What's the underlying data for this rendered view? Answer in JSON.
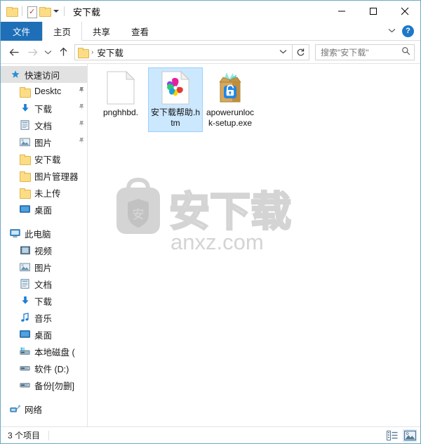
{
  "window": {
    "title": "安下载",
    "quick_access_toolbar": [
      {
        "name": "folder-icon",
        "label": "文件夹"
      },
      {
        "name": "properties-icon",
        "label": "属性"
      },
      {
        "name": "new-folder-icon",
        "label": "新建文件夹"
      },
      {
        "name": "chevron-down-icon",
        "label": "自定义快速访问工具栏"
      }
    ],
    "controls": {
      "minimize": "最小化",
      "maximize": "最大化",
      "close": "关闭"
    }
  },
  "ribbon": {
    "tabs": [
      {
        "label": "文件",
        "state": "file"
      },
      {
        "label": "主页",
        "state": "active"
      },
      {
        "label": "共享",
        "state": "normal"
      },
      {
        "label": "查看",
        "state": "normal"
      }
    ],
    "collapse_icon": "⌄",
    "help_label": "?",
    "accent_color": "#1e6fb8"
  },
  "address": {
    "back_label": "后退",
    "forward_label": "前进",
    "recent_label": "最近浏览的位置",
    "up_label": "上移到",
    "breadcrumb": [
      "安下载"
    ],
    "dropdown_label": "以前的位置",
    "refresh_label": "刷新",
    "separator": "›"
  },
  "search": {
    "placeholder": "搜索\"安下载\"",
    "icon": "search-icon"
  },
  "sidebar": {
    "groups": [
      {
        "header": {
          "label": "快速访问",
          "icon": "star-pin-icon",
          "selected": true
        },
        "items": [
          {
            "label": "Desktc",
            "icon": "folder-icon",
            "pinned": true
          },
          {
            "label": "下载",
            "icon": "downloads-icon",
            "pinned": true
          },
          {
            "label": "文档",
            "icon": "documents-icon",
            "pinned": true
          },
          {
            "label": "图片",
            "icon": "pictures-icon",
            "pinned": true
          },
          {
            "label": "安下载",
            "icon": "folder-icon",
            "pinned": false
          },
          {
            "label": "图片管理器",
            "icon": "folder-icon",
            "pinned": false
          },
          {
            "label": "未上传",
            "icon": "folder-icon",
            "pinned": false
          },
          {
            "label": "桌面",
            "icon": "desktop-icon",
            "pinned": false
          }
        ]
      },
      {
        "header": {
          "label": "此电脑",
          "icon": "this-pc-icon",
          "selected": false
        },
        "items": [
          {
            "label": "视频",
            "icon": "videos-icon",
            "pinned": false
          },
          {
            "label": "图片",
            "icon": "pictures-icon",
            "pinned": false
          },
          {
            "label": "文档",
            "icon": "documents-icon",
            "pinned": false
          },
          {
            "label": "下载",
            "icon": "downloads-icon",
            "pinned": false
          },
          {
            "label": "音乐",
            "icon": "music-icon",
            "pinned": false
          },
          {
            "label": "桌面",
            "icon": "desktop-icon",
            "pinned": false
          },
          {
            "label": "本地磁盘 (",
            "icon": "system-drive-icon",
            "pinned": false
          },
          {
            "label": "软件 (D:)",
            "icon": "drive-icon",
            "pinned": false
          },
          {
            "label": "备份[勿删]",
            "icon": "drive-icon",
            "pinned": false
          }
        ]
      },
      {
        "header": {
          "label": "网络",
          "icon": "network-icon",
          "selected": false
        },
        "items": []
      }
    ]
  },
  "files": [
    {
      "name": "pnghhbd.",
      "icon": "blank-document-icon",
      "selected": false
    },
    {
      "name": "安下载帮助.htm",
      "icon": "html-browser-icon",
      "selected": true
    },
    {
      "name": "apowerunlock-setup.exe",
      "icon": "setup-package-icon",
      "selected": false
    }
  ],
  "watermark": {
    "brand_text": "安下载",
    "domain_text": "anxz.com",
    "shield_glyph": "安",
    "color": "#d4d4d4"
  },
  "statusbar": {
    "item_count_text": "3 个项目",
    "views": [
      {
        "name": "details-view-button",
        "label": "详细信息",
        "active": false
      },
      {
        "name": "large-icons-view-button",
        "label": "大图标",
        "active": true
      }
    ]
  }
}
